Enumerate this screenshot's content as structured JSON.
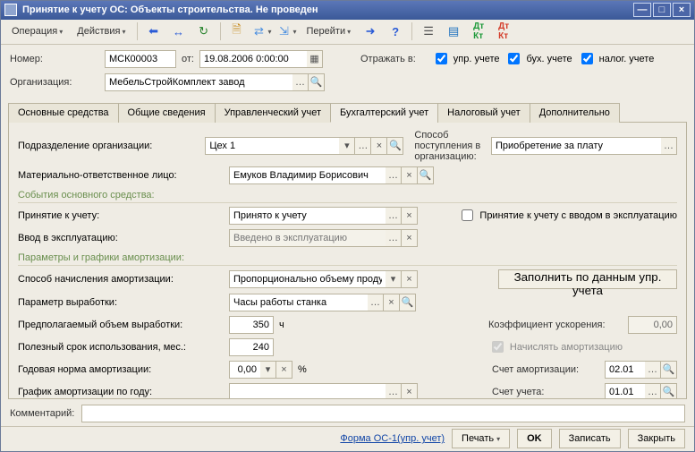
{
  "title": "Принятие к учету ОС: Объекты строительства. Не проведен",
  "menu": {
    "operation": "Операция",
    "actions": "Действия",
    "goto": "Перейти"
  },
  "header": {
    "number_label": "Номер:",
    "number": "МСК00003",
    "from_label": "от:",
    "date": "19.08.2006 0:00:00",
    "org_label": "Организация:",
    "org": "МебельСтройКомплект завод",
    "reflect_label": "Отражать в:",
    "chk_upr": "упр. учете",
    "chk_bukh": "бух. учете",
    "chk_nalog": "налог. учете"
  },
  "tabs": [
    "Основные средства",
    "Общие сведения",
    "Управленческий учет",
    "Бухгалтерский учет",
    "Налоговый учет",
    "Дополнительно"
  ],
  "active_tab": 3,
  "body": {
    "podr_label": "Подразделение организации:",
    "podr": "Цех 1",
    "mol_label": "Материально-ответственное лицо:",
    "mol": "Емуков Владимир Борисович",
    "sposob_post_label": "Способ поступления в организацию:",
    "sposob_post": "Приобретение за плату",
    "events_title": "События основного средства:",
    "accept_label": "Принятие к учету:",
    "accept_val": "Принято к учету",
    "vvod_label": "Ввод в эксплуатацию:",
    "vvod_placeholder": "Введено в эксплуатацию",
    "accept_with_vvod": "Принятие к учету с вводом в эксплуатацию",
    "amort_title": "Параметры и графики амортизации:",
    "sposob_amort_label": "Способ начисления амортизации:",
    "sposob_amort": "Пропорционально объему продукции (работ",
    "fill_by_upr": "Заполнить по данным упр. учета",
    "param_label": "Параметр выработки:",
    "param": "Часы работы станка",
    "vol_label": "Предполагаемый объем выработки:",
    "vol": "350",
    "vol_unit": "ч",
    "koeff_label": "Коэффициент ускорения:",
    "koeff": "0,00",
    "life_label": "Полезный срок использования, мес.:",
    "life": "240",
    "calc_amort": "Начислять амортизацию",
    "year_rate_label": "Годовая норма амортизации:",
    "year_rate": "0,00",
    "percent": "%",
    "acct_amort_label": "Счет амортизации:",
    "acct_amort": "02.01",
    "graph_label": "График амортизации по году:",
    "acct_uch_label": "Счет учета:",
    "acct_uch": "01.01"
  },
  "footer": {
    "comment_label": "Комментарий:",
    "form_link": "Форма ОС-1(упр. учет)",
    "print": "Печать",
    "ok": "OK",
    "save": "Записать",
    "close": "Закрыть"
  }
}
